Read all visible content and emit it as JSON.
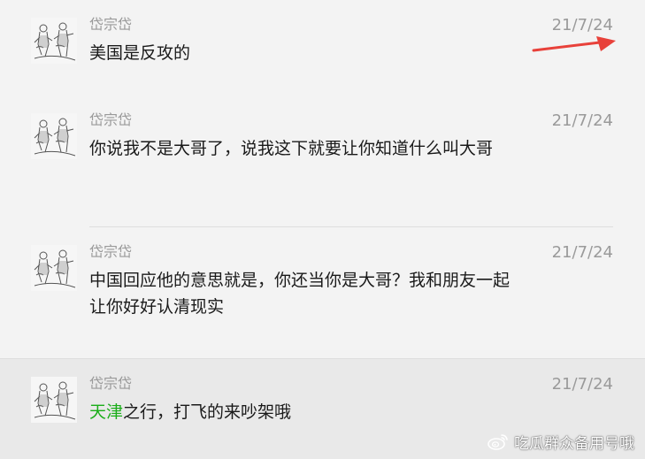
{
  "messages": [
    {
      "sender": "岱宗岱",
      "date": "21/7/24",
      "text": "美国是反攻的"
    },
    {
      "sender": "岱宗岱",
      "date": "21/7/24",
      "text": "你说我不是大哥了，说我这下就要让你知道什么叫大哥"
    },
    {
      "sender": "岱宗岱",
      "date": "21/7/24",
      "text": "中国回应他的意思就是，你还当你是大哥？我和朋友一起让你好好认清现实"
    },
    {
      "sender": "岱宗岱",
      "date": "21/7/24",
      "text_highlight": "天津",
      "text_rest": "之行，打飞的来吵架哦"
    }
  ],
  "colors": {
    "highlight": "#1aad19",
    "arrow": "#e8413a"
  },
  "icons": {
    "avatar": "sketch-figures-avatar-icon",
    "annotation": "red-arrow-annotation",
    "watermark_logo": "weibo-logo-icon"
  },
  "watermark": {
    "text": "吃瓜群众备用号哦"
  }
}
